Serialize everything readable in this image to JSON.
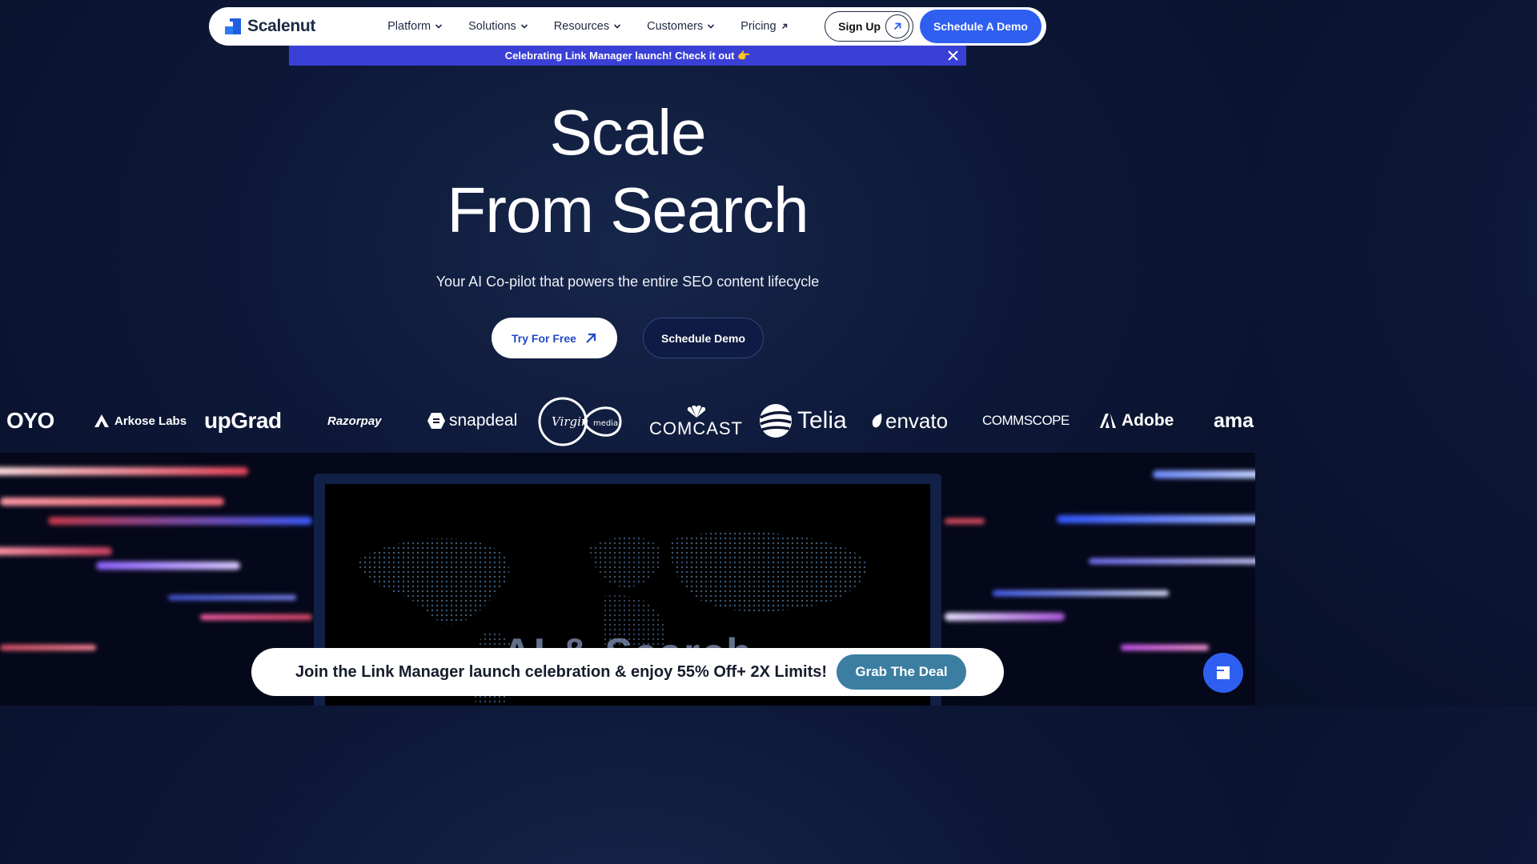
{
  "brand": {
    "name": "Scalenut"
  },
  "nav": {
    "items": [
      {
        "label": "Platform",
        "icon": "chevron-down-icon"
      },
      {
        "label": "Solutions",
        "icon": "chevron-down-icon"
      },
      {
        "label": "Resources",
        "icon": "chevron-down-icon"
      },
      {
        "label": "Customers",
        "icon": "chevron-down-icon"
      },
      {
        "label": "Pricing",
        "icon": "arrow-up-right-icon"
      }
    ],
    "signup_label": "Sign Up",
    "demo_label": "Schedule A Demo"
  },
  "announcement": {
    "text": "Celebrating Link Manager launch! Check it out 👉"
  },
  "hero": {
    "title_line1": "Scale",
    "title_line2": "From Search",
    "subtitle": "Your AI Co-pilot that powers the entire SEO content lifecycle",
    "cta_primary": "Try For Free",
    "cta_secondary": "Schedule Demo"
  },
  "customer_logos": {
    "oyo": "OYO",
    "arkose": "Arkose Labs",
    "upgrad": "upGrad",
    "razorpay": "Razorpay",
    "snapdeal": "snapdeal",
    "virgin": "Virgin media",
    "comcast": "COMCAST",
    "telia": "Telia",
    "envato": "envato",
    "commscope": "COMMSCOPE",
    "adobe": "Adobe",
    "amazon": "ama"
  },
  "video": {
    "overlay_text": "AI & Search"
  },
  "promo": {
    "text": "Join the Link Manager launch celebration & enjoy 55% Off+ 2X Limits!",
    "button_label": "Grab The Deal"
  },
  "colors": {
    "accent_blue": "#2f5ff0",
    "announce_bg": "#3a3fd6",
    "page_bg": "#0d1838",
    "promo_button": "#3b7ea1"
  }
}
